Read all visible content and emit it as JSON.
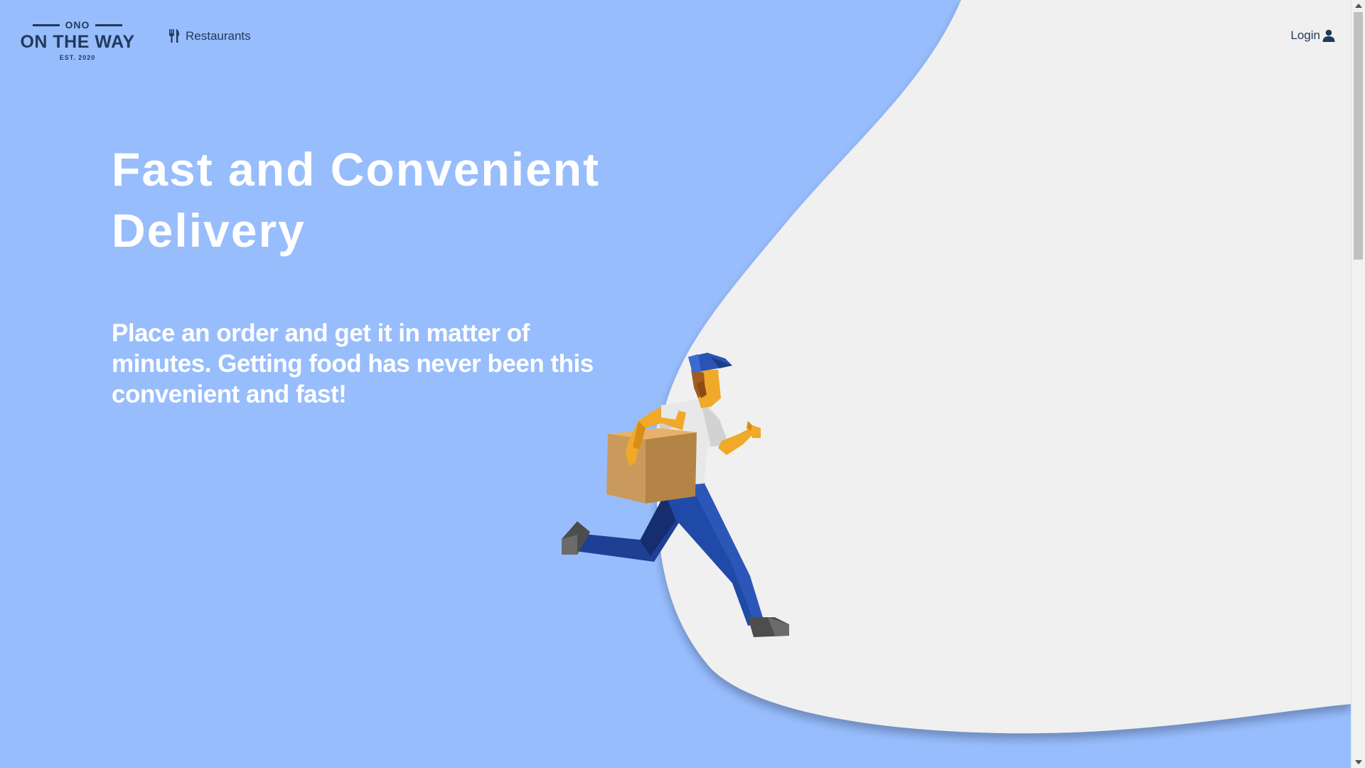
{
  "brand": {
    "top": "ONO",
    "name": "ON THE WAY",
    "est": "EST. 2020"
  },
  "nav": {
    "restaurants_label": "Restaurants",
    "restaurants_icon": "utensils-icon",
    "login_label": "Login",
    "login_icon": "user-icon"
  },
  "hero": {
    "title": "Fast and Convenient Delivery",
    "subtitle": "Place an order and get it in matter of minutes. Getting food has never been this convenient and fast!"
  },
  "colors": {
    "background": "#98bdfc",
    "blob": "#f0f0f0",
    "text_dark": "#213a5c",
    "text_light": "#ffffff"
  }
}
